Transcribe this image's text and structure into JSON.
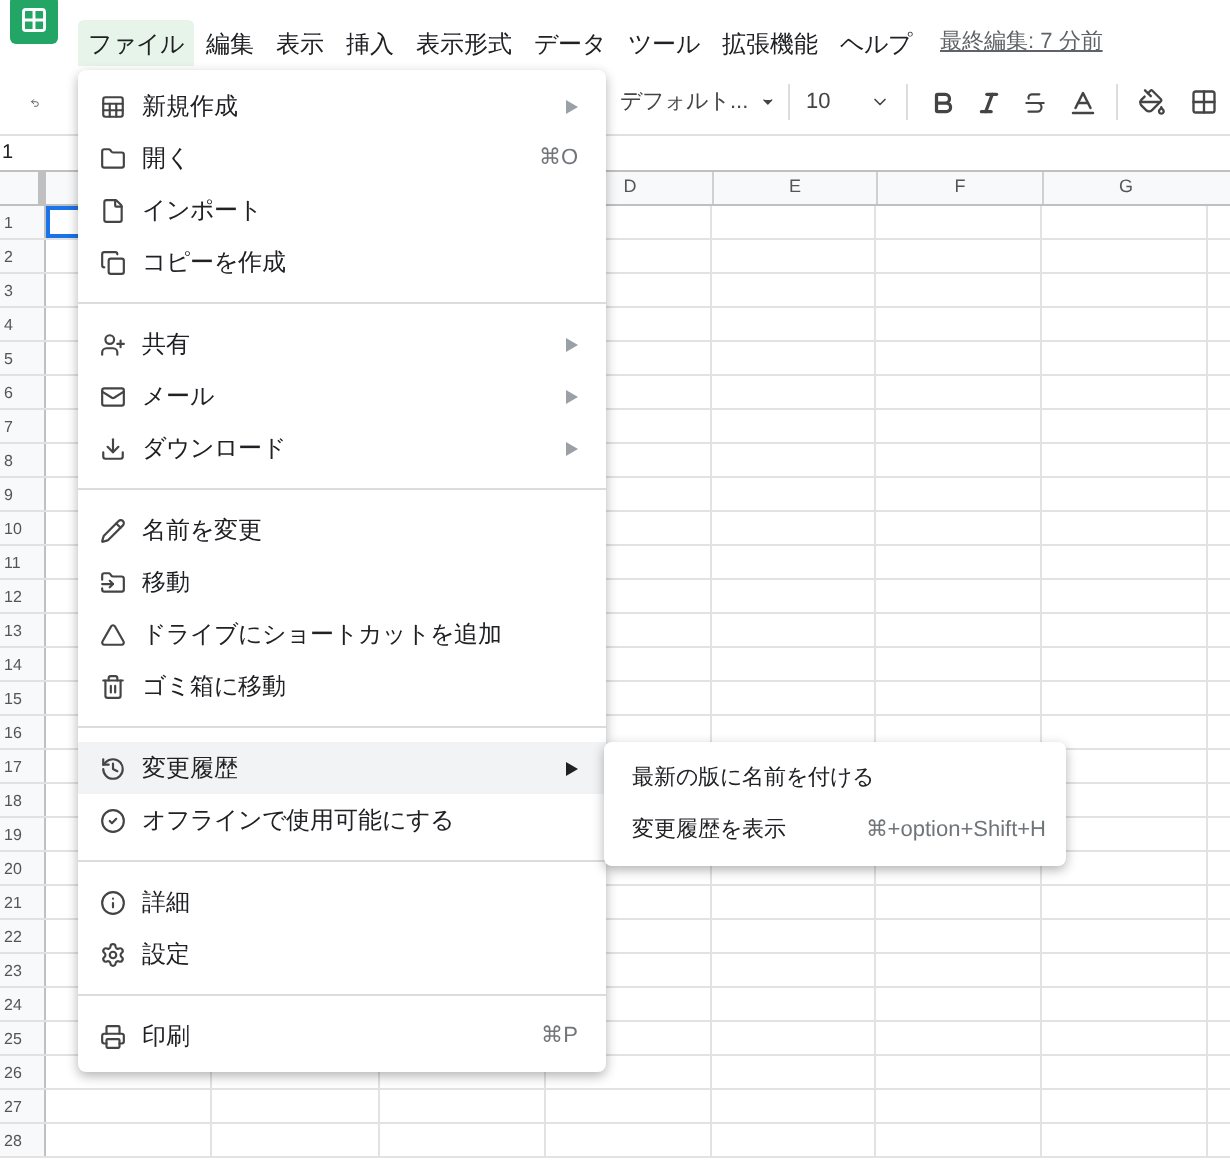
{
  "menu_bar": [
    {
      "label": "ファイル",
      "selected": true
    },
    {
      "label": "編集",
      "selected": false
    },
    {
      "label": "表示",
      "selected": false
    },
    {
      "label": "挿入",
      "selected": false
    },
    {
      "label": "表示形式",
      "selected": false
    },
    {
      "label": "データ",
      "selected": false
    },
    {
      "label": "ツール",
      "selected": false
    },
    {
      "label": "拡張機能",
      "selected": false
    },
    {
      "label": "ヘルプ",
      "selected": false
    }
  ],
  "last_edit": "最終編集: 7 分前",
  "toolbar": {
    "font": "デフォルト...",
    "font_size": "10"
  },
  "name_box": "1",
  "columns": [
    "D",
    "E",
    "F",
    "G"
  ],
  "rows": [
    "1",
    "2",
    "3",
    "4",
    "5",
    "6",
    "7",
    "8",
    "9",
    "10",
    "11",
    "12",
    "13",
    "14",
    "15",
    "16",
    "17",
    "18",
    "19",
    "20",
    "21",
    "22",
    "23",
    "24",
    "25",
    "26",
    "27",
    "28"
  ],
  "file_menu": [
    {
      "kind": "item",
      "label": "新規作成",
      "has_submenu": true,
      "selected": false
    },
    {
      "kind": "item",
      "label": "開く",
      "shortcut": "⌘O",
      "has_submenu": false,
      "selected": false
    },
    {
      "kind": "item",
      "label": "インポート",
      "has_submenu": false,
      "selected": false
    },
    {
      "kind": "item",
      "label": "コピーを作成",
      "has_submenu": false,
      "selected": false
    },
    {
      "kind": "separator"
    },
    {
      "kind": "item",
      "label": "共有",
      "has_submenu": true,
      "selected": false
    },
    {
      "kind": "item",
      "label": "メール",
      "has_submenu": true,
      "selected": false
    },
    {
      "kind": "item",
      "label": "ダウンロード",
      "has_submenu": true,
      "selected": false
    },
    {
      "kind": "separator"
    },
    {
      "kind": "item",
      "label": "名前を変更",
      "has_submenu": false,
      "selected": false
    },
    {
      "kind": "item",
      "label": "移動",
      "has_submenu": false,
      "selected": false
    },
    {
      "kind": "item",
      "label": "ドライブにショートカットを追加",
      "has_submenu": false,
      "selected": false
    },
    {
      "kind": "item",
      "label": "ゴミ箱に移動",
      "has_submenu": false,
      "selected": false
    },
    {
      "kind": "separator"
    },
    {
      "kind": "item",
      "label": "変更履歴",
      "has_submenu": true,
      "selected": true
    },
    {
      "kind": "item",
      "label": "オフラインで使用可能にする",
      "has_submenu": false,
      "selected": false
    },
    {
      "kind": "separator"
    },
    {
      "kind": "item",
      "label": "詳細",
      "has_submenu": false,
      "selected": false
    },
    {
      "kind": "item",
      "label": "設定",
      "has_submenu": false,
      "selected": false
    },
    {
      "kind": "separator"
    },
    {
      "kind": "item",
      "label": "印刷",
      "shortcut": "⌘P",
      "has_submenu": false,
      "selected": false
    }
  ],
  "submenu": [
    {
      "label": "最新の版に名前を付ける"
    },
    {
      "label": "変更履歴を表示",
      "shortcut": "⌘+option+Shift+H"
    }
  ]
}
